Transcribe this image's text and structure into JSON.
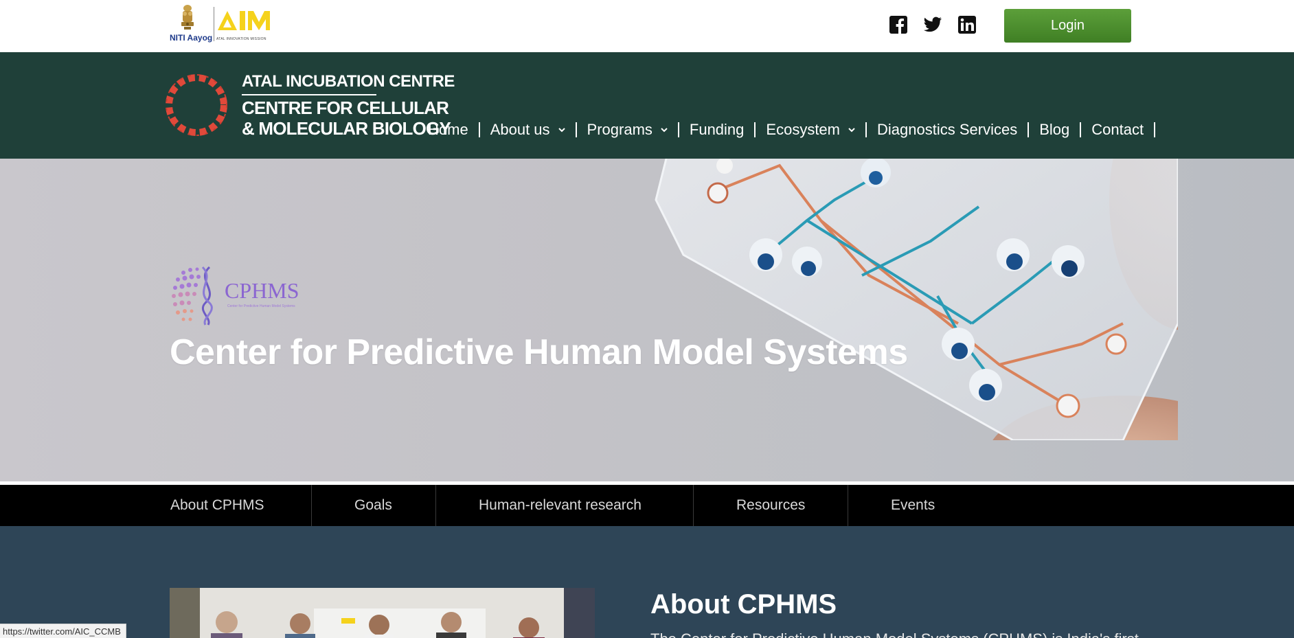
{
  "topbar": {
    "niti_text": "NITI Aayog",
    "aim_subtitle": "ATAL INNOVATION MISSION",
    "login_label": "Login",
    "social_icons": [
      "facebook-icon",
      "twitter-icon",
      "linkedin-icon"
    ]
  },
  "header": {
    "logo_line1": "ATAL INCUBATION CENTRE",
    "logo_line2": "CENTRE FOR CELLULAR",
    "logo_line3": "& MOLECULAR BIOLOGY",
    "nav": [
      {
        "label": "Home",
        "dropdown": false
      },
      {
        "label": "About us",
        "dropdown": true
      },
      {
        "label": "Programs",
        "dropdown": true
      },
      {
        "label": "Funding",
        "dropdown": false
      },
      {
        "label": "Ecosystem",
        "dropdown": true
      },
      {
        "label": "Diagnostics Services",
        "dropdown": false
      },
      {
        "label": "Blog",
        "dropdown": false
      },
      {
        "label": "Contact",
        "dropdown": false
      }
    ]
  },
  "hero": {
    "logo_word": "CPHMS",
    "logo_tagline": "Center for Predictive Human Model Systems",
    "title": "Center for Predictive Human Model Systems"
  },
  "subnav": [
    "About CPHMS",
    "Goals",
    "Human-relevant research",
    "Resources",
    "Events"
  ],
  "content": {
    "about_title": "About CPHMS",
    "about_text": "The Center for Predictive Human Model Systems (CPHMS) is India's first"
  },
  "statusbar": {
    "url": "https://twitter.com/AIC_CCMB"
  },
  "colors": {
    "header_bg": "#1f4039",
    "login_green": "#4a8c2e",
    "subnav_bg": "#000000",
    "content_bg": "#2e4557",
    "logo_ring": "#e0493a",
    "cphms_purple": "#8b66d1"
  }
}
